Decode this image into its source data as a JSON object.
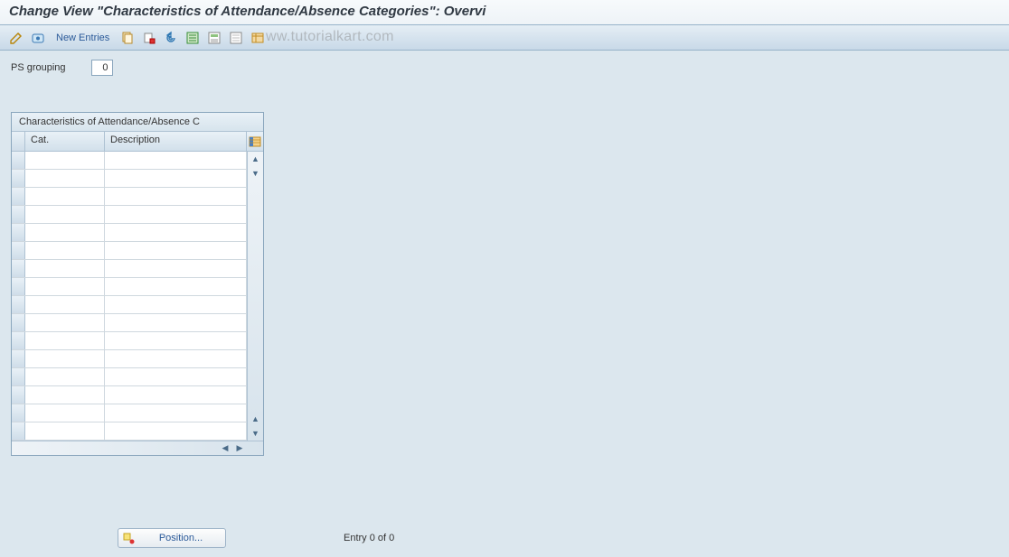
{
  "title": "Change View \"Characteristics of Attendance/Absence Categories\": Overvi",
  "toolbar": {
    "new_entries": "New Entries",
    "watermark": "ww.tutorialkart.com"
  },
  "field": {
    "ps_grouping_label": "PS grouping",
    "ps_grouping_value": "0"
  },
  "table": {
    "title": "Characteristics of Attendance/Absence C",
    "columns": {
      "cat": "Cat.",
      "desc": "Description"
    },
    "rows": [
      "",
      "",
      "",
      "",
      "",
      "",
      "",
      "",
      "",
      "",
      "",
      "",
      "",
      "",
      "",
      ""
    ]
  },
  "footer": {
    "position_label": "Position...",
    "entry_status": "Entry 0 of 0"
  }
}
